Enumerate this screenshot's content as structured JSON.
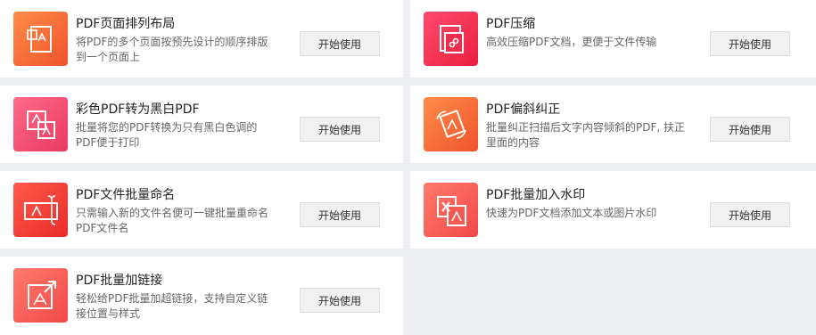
{
  "tools": [
    {
      "title": "PDF页面排列布局",
      "desc": "将PDF的多个页面按预先设计的顺序排版到一个页面上",
      "button": "开始使用",
      "icon": "pdf-page-layout-icon",
      "color": "#f4623a"
    },
    {
      "title": "PDF压缩",
      "desc": "高效压缩PDF文档，更便于文件传输",
      "button": "开始使用",
      "icon": "pdf-compress-icon",
      "color": "#ef2d4c"
    },
    {
      "title": "彩色PDF转为黑白PDF",
      "desc": "批量将您的PDF转换为只有黑白色调的PDF便于打印",
      "button": "开始使用",
      "icon": "pdf-color-to-bw-icon",
      "color": "#ee4a70"
    },
    {
      "title": "PDF偏斜纠正",
      "desc": "批量纠正扫描后文字内容倾斜的PDF, 扶正里面的内容",
      "button": "开始使用",
      "icon": "pdf-deskew-icon",
      "color": "#f4623a"
    },
    {
      "title": "PDF文件批量命名",
      "desc": "只需输入新的文件名便可一键批量重命名PDF文件名",
      "button": "开始使用",
      "icon": "pdf-batch-rename-icon",
      "color": "#ee3b34"
    },
    {
      "title": "PDF批量加入水印",
      "desc": "快速为PDF文档添加文本或图片水印",
      "button": "开始使用",
      "icon": "pdf-watermark-icon",
      "color": "#f45a52"
    },
    {
      "title": "PDF批量加链接",
      "desc": "轻松给PDF批量加超链接，支持自定义链接位置与样式",
      "button": "开始使用",
      "icon": "pdf-add-link-icon",
      "color": "#f25247"
    }
  ]
}
